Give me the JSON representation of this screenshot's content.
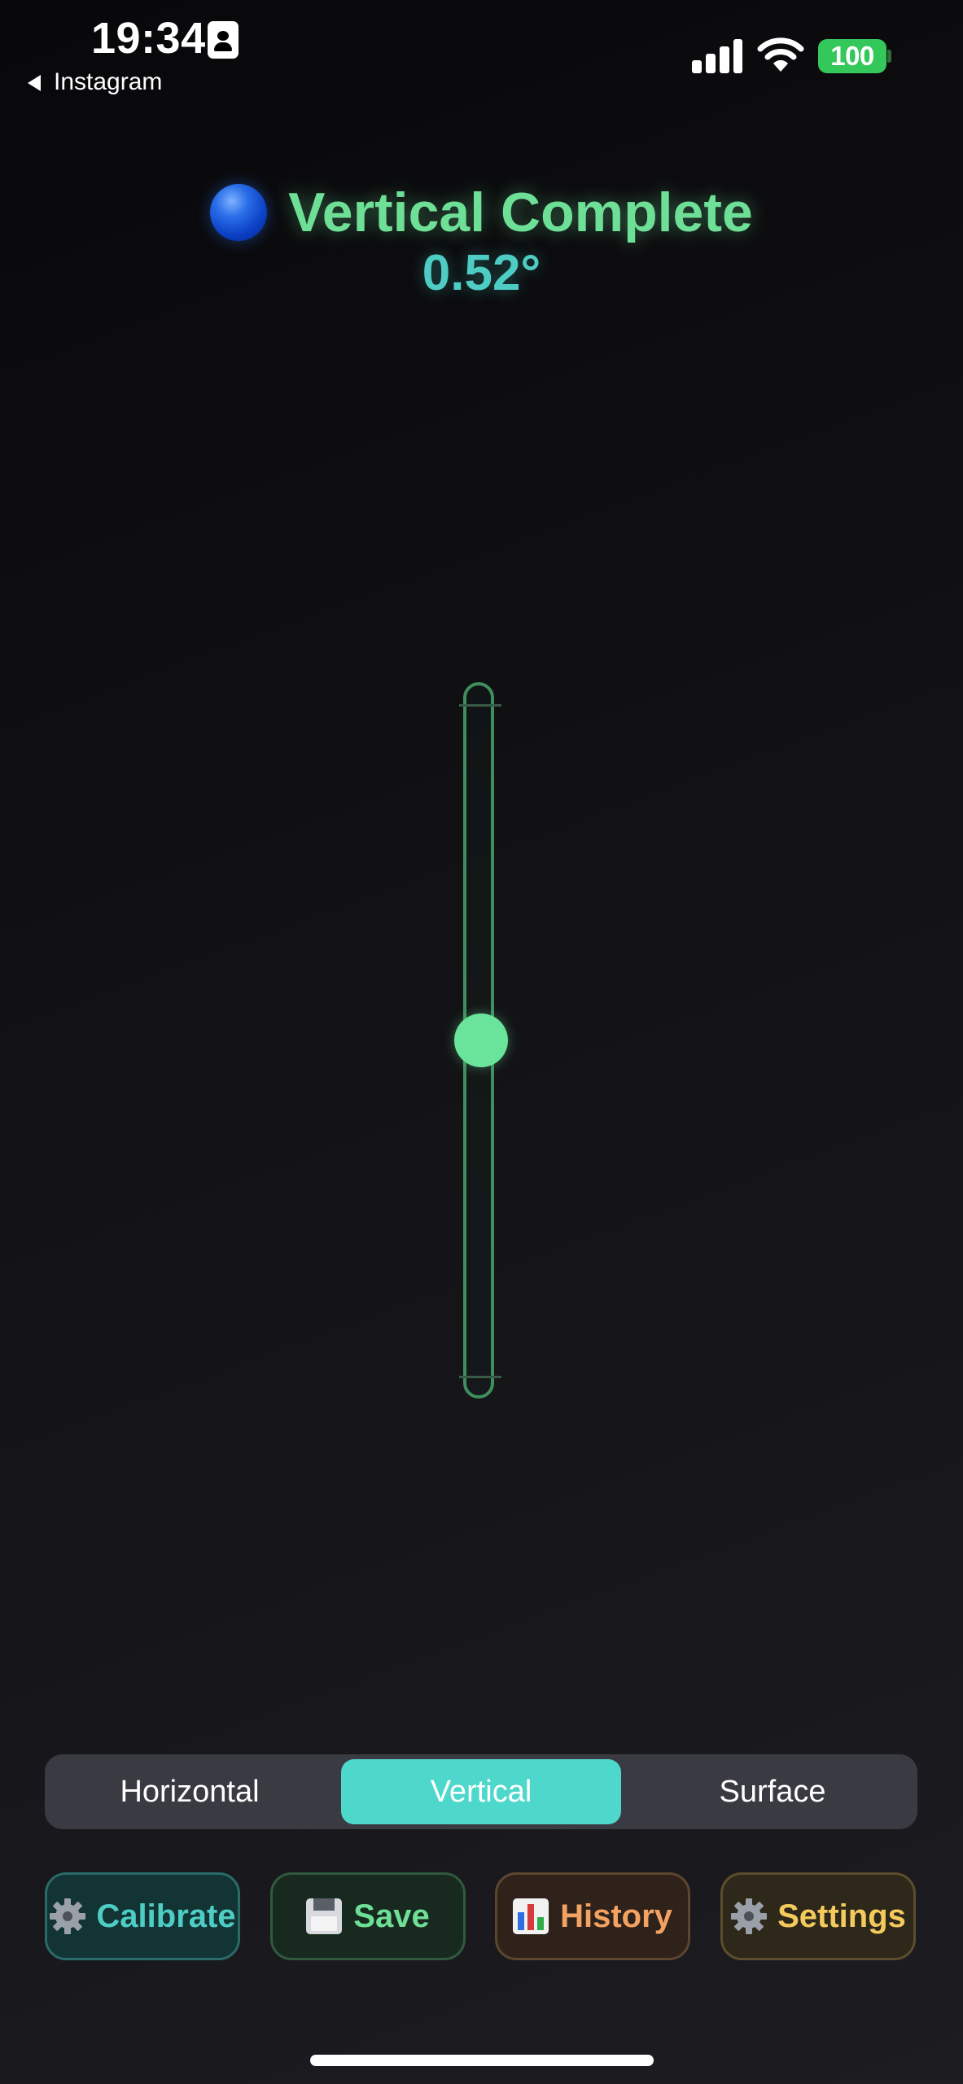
{
  "status_bar": {
    "time": "19:34",
    "back_label": "Instagram",
    "battery": "100",
    "icons": [
      "id-badge-icon",
      "back-arrow-icon",
      "signal-icon",
      "wifi-icon",
      "battery-icon"
    ]
  },
  "header": {
    "icon": "blue-circle-icon",
    "title": "Vertical Complete",
    "angle": "0.52°"
  },
  "level": {
    "bubble_fraction": 0.5,
    "tube_color": "#3f8e5e",
    "bubble_color": "#6ae49a"
  },
  "modes": {
    "items": [
      "Horizontal",
      "Vertical",
      "Surface"
    ],
    "selected": "Vertical"
  },
  "actions": {
    "calibrate": {
      "label": "Calibrate",
      "icon": "gear-icon",
      "color": "#4ecdc4"
    },
    "save": {
      "label": "Save",
      "icon": "floppy-disk-icon",
      "color": "#6edf96"
    },
    "history": {
      "label": "History",
      "icon": "bar-chart-icon",
      "color": "#f4a261"
    },
    "settings": {
      "label": "Settings",
      "icon": "gear-icon",
      "color": "#f4c95d"
    }
  },
  "colors": {
    "accent": "#4ed8cc",
    "title_green": "#6edf96",
    "angle_teal": "#4ecdc4"
  }
}
